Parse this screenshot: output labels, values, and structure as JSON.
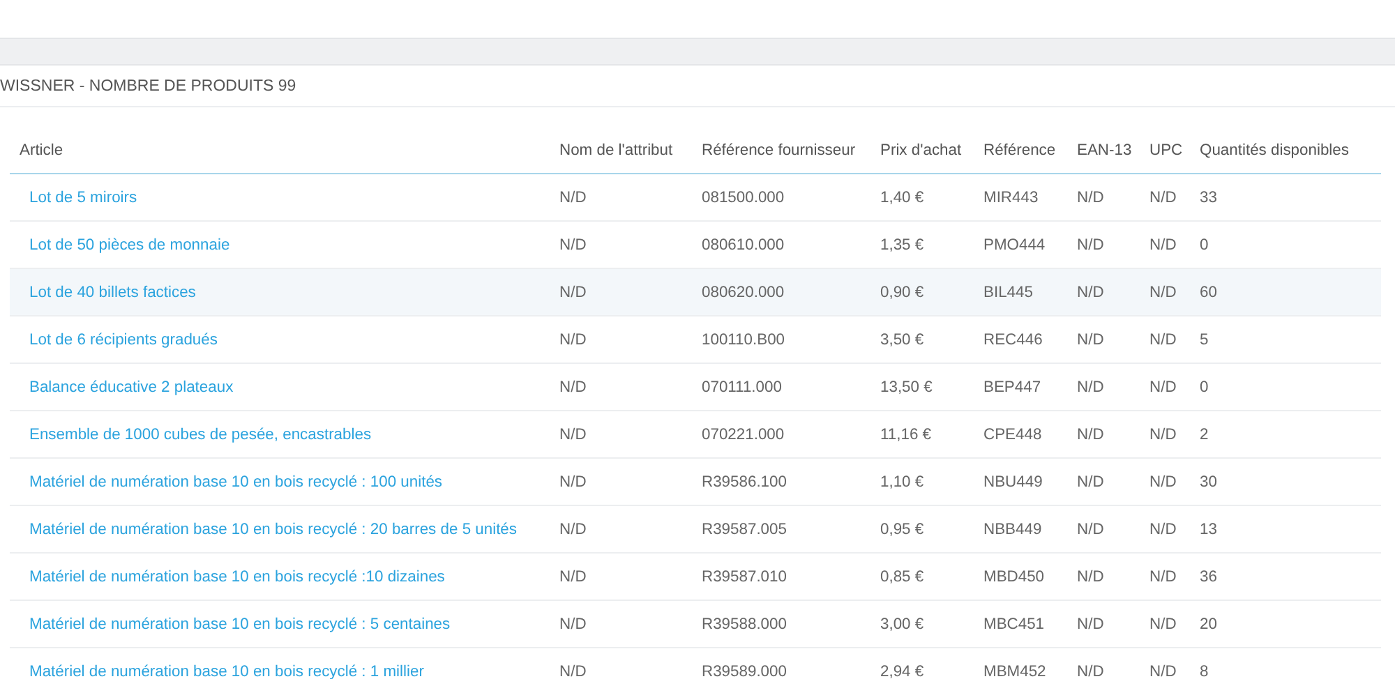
{
  "panel": {
    "title": "WISSNER - NOMBRE DE PRODUITS 99"
  },
  "table": {
    "columns": [
      "Article",
      "Nom de l'attribut",
      "Référence fournisseur",
      "Prix d'achat",
      "Référence",
      "EAN-13",
      "UPC",
      "Quantités disponibles"
    ],
    "rows": [
      {
        "selected": false,
        "cells": [
          "Lot de 5 miroirs",
          "N/D",
          "081500.000",
          "1,40 €",
          "MIR443",
          "N/D",
          "N/D",
          "33"
        ]
      },
      {
        "selected": false,
        "cells": [
          "Lot de 50 pièces de monnaie",
          "N/D",
          "080610.000",
          "1,35 €",
          "PMO444",
          "N/D",
          "N/D",
          "0"
        ]
      },
      {
        "selected": true,
        "cells": [
          "Lot de 40 billets factices",
          "N/D",
          "080620.000",
          "0,90 €",
          "BIL445",
          "N/D",
          "N/D",
          "60"
        ]
      },
      {
        "selected": false,
        "cells": [
          "Lot de 6 récipients gradués",
          "N/D",
          "100110.B00",
          "3,50 €",
          "REC446",
          "N/D",
          "N/D",
          "5"
        ]
      },
      {
        "selected": false,
        "cells": [
          "Balance éducative 2 plateaux",
          "N/D",
          "070111.000",
          "13,50 €",
          "BEP447",
          "N/D",
          "N/D",
          "0"
        ]
      },
      {
        "selected": false,
        "cells": [
          "Ensemble de 1000 cubes de pesée, encastrables",
          "N/D",
          "070221.000",
          "11,16 €",
          "CPE448",
          "N/D",
          "N/D",
          "2"
        ]
      },
      {
        "selected": false,
        "cells": [
          "Matériel de numération base 10 en bois recyclé : 100 unités",
          "N/D",
          "R39586.100",
          "1,10 €",
          "NBU449",
          "N/D",
          "N/D",
          "30"
        ]
      },
      {
        "selected": false,
        "cells": [
          "Matériel de numération base 10 en bois recyclé : 20 barres de 5 unités",
          "N/D",
          "R39587.005",
          "0,95 €",
          "NBB449",
          "N/D",
          "N/D",
          "13"
        ]
      },
      {
        "selected": false,
        "cells": [
          "Matériel de numération base 10 en bois recyclé :10 dizaines",
          "N/D",
          "R39587.010",
          "0,85 €",
          "MBD450",
          "N/D",
          "N/D",
          "36"
        ]
      },
      {
        "selected": false,
        "cells": [
          "Matériel de numération base 10 en bois recyclé : 5 centaines",
          "N/D",
          "R39588.000",
          "3,00 €",
          "MBC451",
          "N/D",
          "N/D",
          "20"
        ]
      },
      {
        "selected": false,
        "cells": [
          "Matériel de numération base 10 en bois recyclé : 1 millier",
          "N/D",
          "R39589.000",
          "2,94 €",
          "MBM452",
          "N/D",
          "N/D",
          "8"
        ]
      }
    ]
  }
}
